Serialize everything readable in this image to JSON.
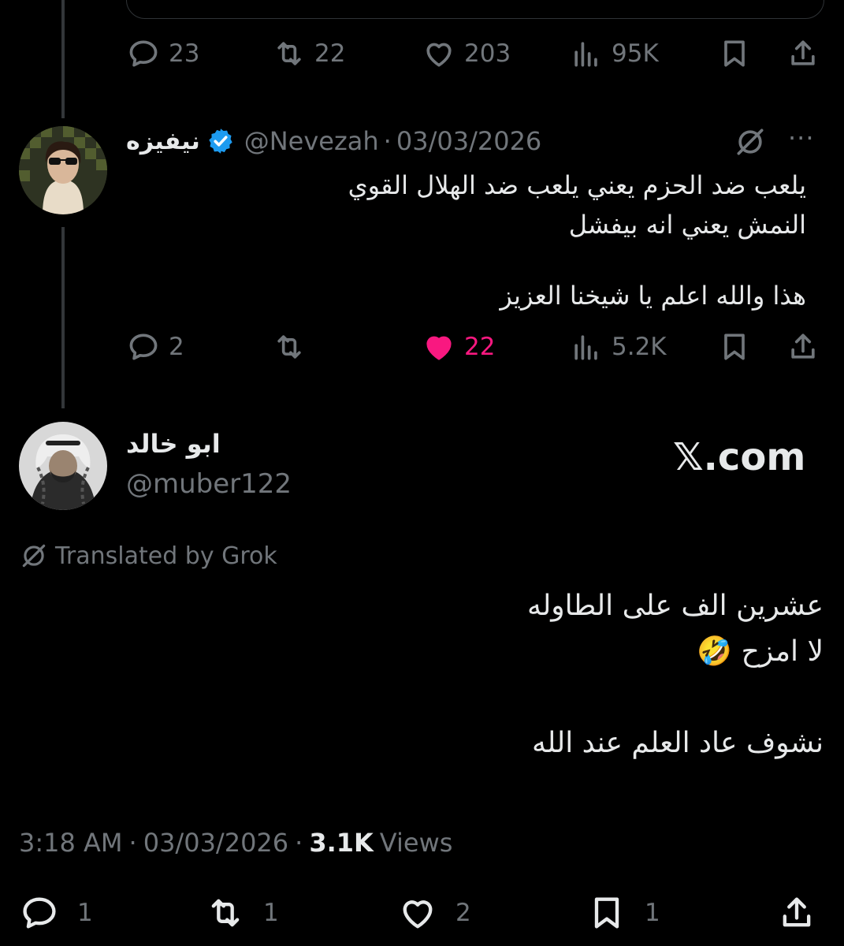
{
  "top_actions": {
    "replies": "23",
    "reposts": "22",
    "likes": "203",
    "views": "95K"
  },
  "reply_tweet": {
    "display_name": "نيفيزه",
    "handle": "@Nevezah",
    "separator": "·",
    "date": "03/03/2026",
    "more": "···",
    "lines": [
      "يلعب ضد الحزم يعني يلعب ضد الهلال القوي",
      "النمش يعني انه بيفشل",
      "هذا والله اعلم يا شيخنا العزيز"
    ],
    "actions": {
      "replies": "2",
      "reposts": "",
      "likes": "22",
      "views": "5.2K"
    },
    "like_color": "#f91880"
  },
  "main_tweet": {
    "display_name": "ابو خالد",
    "handle": "@muber122",
    "watermark": "𝕏.com",
    "translated_label": "Translated by Grok",
    "lines": [
      "عشرين الف على الطاوله",
      "لا امزح 🤣",
      "نشوف عاد العلم عند الله"
    ],
    "meta": {
      "time": "3:18 AM",
      "separator": "·",
      "date": "03/03/2026",
      "separator2": "·",
      "views_count": "3.1K",
      "views_label": "Views"
    },
    "actions": {
      "replies": "1",
      "reposts": "1",
      "likes": "2",
      "bookmarks": "1"
    }
  },
  "colors": {
    "background": "#000000",
    "text": "#e7e9ea",
    "muted": "#71767b",
    "verified": "#1d9bf0",
    "like_active": "#f91880"
  }
}
